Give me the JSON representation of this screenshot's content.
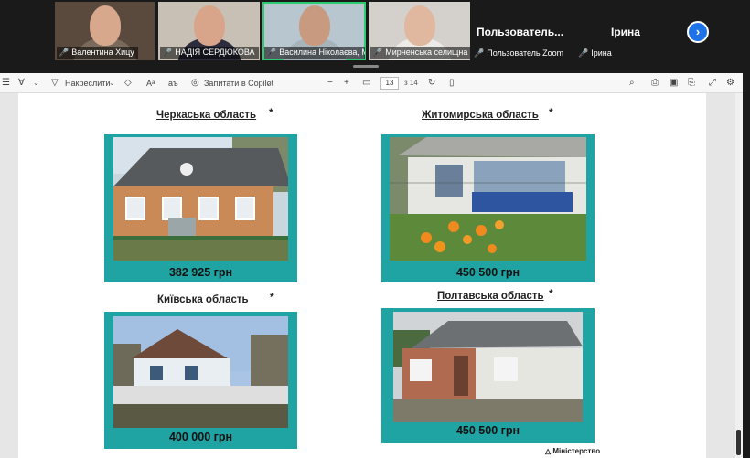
{
  "participants": [
    {
      "name": "Валентина Хицу"
    },
    {
      "name": "НАДІЯ СЕРДЮКОВА"
    },
    {
      "name": "Василина Ніколаєва, Мир..."
    },
    {
      "name": "Мирненська селищна ..."
    }
  ],
  "name_only_tiles": [
    {
      "title": "Пользователь...",
      "chip": "Пользователь Zoom"
    },
    {
      "title": "Ірина",
      "chip": "Ірина"
    }
  ],
  "toolbar": {
    "draw_label": "Накреслити",
    "aa_label": "Aᵃ",
    "copilot_label": "Запитати в Copilot",
    "minus": "−",
    "plus": "+",
    "page_current": "13",
    "page_total": "з 14"
  },
  "regions": [
    {
      "title": "Черкаська область",
      "star": "*",
      "price": "382 925 грн"
    },
    {
      "title": "Житомирська область",
      "star": "*",
      "price": "450 500 грн"
    },
    {
      "title": "Київська область",
      "star": "*",
      "price": "400 000 грн"
    },
    {
      "title": "Полтавська область",
      "star": "*",
      "price": "450 500 грн"
    }
  ],
  "footer_logo": "Міністерство",
  "colors": {
    "card": "#1fa3a3",
    "active_tile": "#2ecc71",
    "next_button": "#1e73e8"
  }
}
